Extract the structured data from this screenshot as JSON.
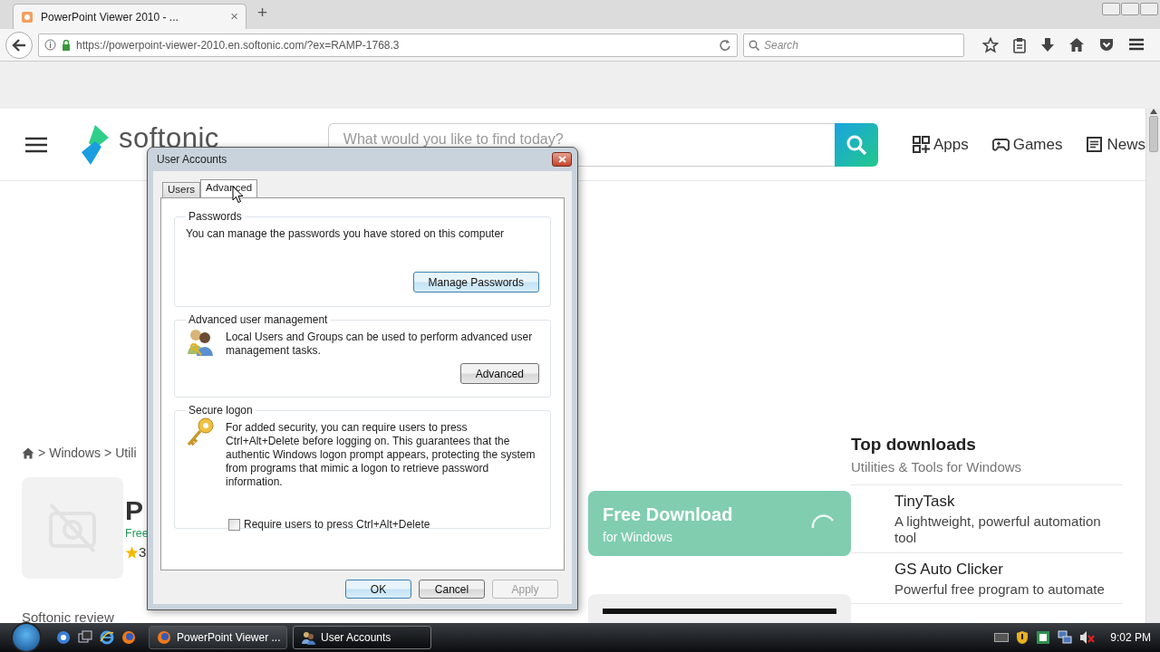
{
  "browser": {
    "tab": {
      "title": "PowerPoint Viewer 2010 - ...",
      "close": "×"
    },
    "new_tab": "+",
    "url": "https://powerpoint-viewer-2010.en.softonic.com/?ex=RAMP-1768.3",
    "search_placeholder": "Search"
  },
  "site": {
    "logo": "softonic",
    "search_placeholder": "What would you like to find today?",
    "nav": [
      "Apps",
      "Games",
      "News"
    ]
  },
  "breadcrumb": [
    {
      "separator": ">",
      "label": "Windows"
    },
    {
      "separator": ">",
      "label": "Utili"
    }
  ],
  "app": {
    "title": "P",
    "license": "Free",
    "rating": "3"
  },
  "review_heading": "Softonic review",
  "download": {
    "label": "Free Download",
    "sub": "for Windows"
  },
  "top_downloads": {
    "title": "Top downloads",
    "subtitle": "Utilities & Tools for Windows",
    "items": [
      {
        "name": "TinyTask",
        "description": "A lightweight, powerful automation tool"
      },
      {
        "name": "GS Auto Clicker",
        "description": "Powerful free program to automate"
      }
    ]
  },
  "dialog": {
    "title": "User Accounts",
    "tabs": [
      {
        "label": "Users",
        "selected": false
      },
      {
        "label": "Advanced",
        "selected": true
      }
    ],
    "groups": [
      {
        "kind": "plain",
        "legend": "Passwords",
        "text": "You can manage the passwords you have stored on this computer",
        "button": {
          "label": "Manage Passwords",
          "focused": true
        }
      },
      {
        "kind": "users",
        "legend": "Advanced user management",
        "text": "Local Users and Groups can be used to perform advanced user management tasks.",
        "button": {
          "label": "Advanced",
          "focused": false
        }
      },
      {
        "kind": "logon",
        "legend": "Secure logon",
        "text": "For added security, you can require users to press Ctrl+Alt+Delete before logging on. This guarantees that the authentic Windows logon prompt appears, protecting the system from programs that mimic a logon to retrieve password information.",
        "checkbox": {
          "label": "Require users to press Ctrl+Alt+Delete",
          "checked": false
        }
      }
    ],
    "buttons": [
      {
        "label": "OK",
        "default": true,
        "disabled": false
      },
      {
        "label": "Cancel",
        "default": false,
        "disabled": false
      },
      {
        "label": "Apply",
        "default": false,
        "disabled": true
      }
    ]
  },
  "taskbar": {
    "tasks": [
      {
        "label": "PowerPoint Viewer ...",
        "selected": false
      },
      {
        "label": "User Accounts",
        "selected": true
      }
    ],
    "clock": "9:02 PM"
  }
}
